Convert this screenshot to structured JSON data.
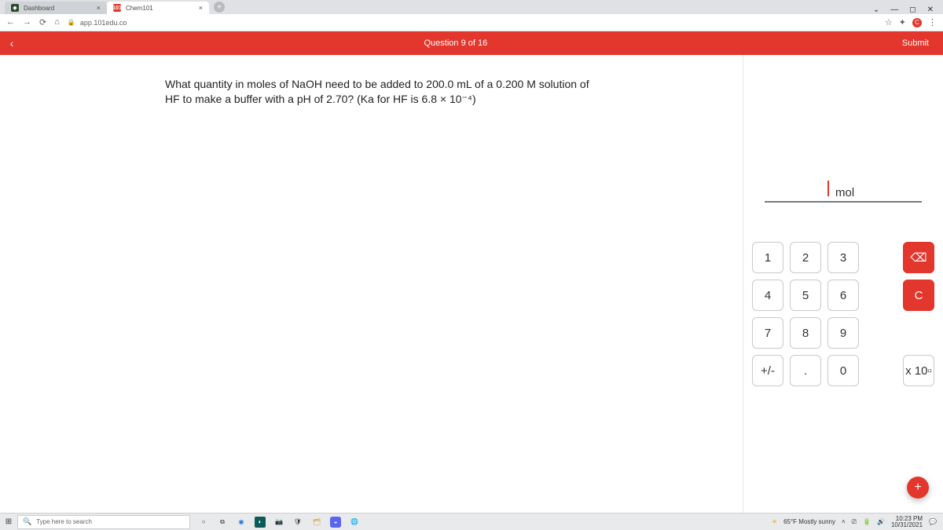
{
  "browser": {
    "tabs": [
      {
        "label": "Dashboard",
        "favicon": "◆"
      },
      {
        "label": "Chem101",
        "favicon": "101"
      }
    ],
    "url": "app.101edu.co"
  },
  "header": {
    "question_label": "Question 9 of 16",
    "submit_label": "Submit"
  },
  "question": {
    "text": "What quantity in moles of NaOH need to be added to 200.0 mL of a 0.200 M solution of HF to make a buffer with a pH of 2.70? (Ka for HF is 6.8 × 10⁻⁴)"
  },
  "answer": {
    "unit": "mol",
    "value": ""
  },
  "keypad": {
    "k1": "1",
    "k2": "2",
    "k3": "3",
    "k4": "4",
    "k5": "5",
    "k6": "6",
    "k7": "7",
    "k8": "8",
    "k9": "9",
    "k0": "0",
    "dot": ".",
    "pm": "+/-",
    "backspace": "⌫",
    "clear": "C",
    "exp": "x 10▫"
  },
  "taskbar": {
    "search_placeholder": "Type here to search",
    "weather": "65°F Mostly sunny",
    "time": "10:23 PM",
    "date": "10/31/2021"
  }
}
